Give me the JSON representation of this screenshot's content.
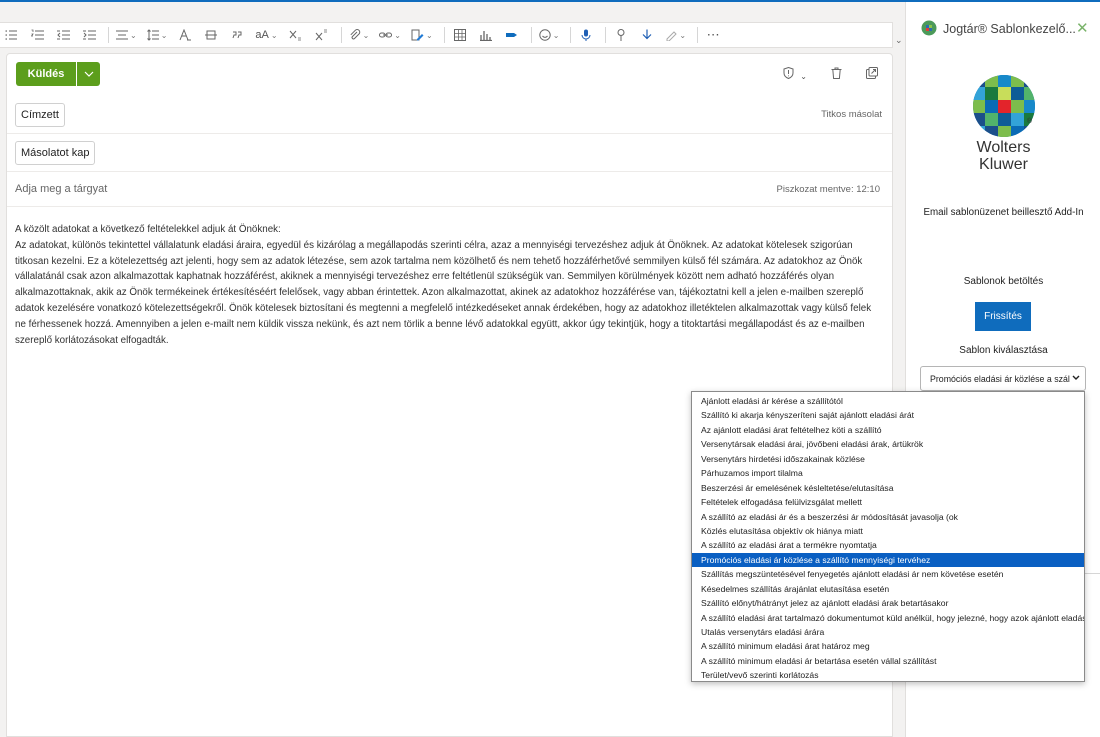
{
  "ribbon": {
    "style_label": "aA"
  },
  "compose": {
    "send_label": "Küldés",
    "to_label": "Címzett",
    "cc_label": "Másolatot kap",
    "bcc_label": "Titkos másolat",
    "subject_placeholder": "Adja meg a tárgyat",
    "draft_saved": "Piszkozat mentve: 12:10",
    "body": [
      "A közölt adatokat a következő feltételekkel adjuk át Önöknek:",
      "Az adatokat, különös tekintettel vállalatunk eladási áraira, egyedül és kizárólag a megállapodás szerinti célra, azaz a mennyiségi tervezéshez adjuk át Önöknek. Az adatokat kötelesek szigorúan titkosan kezelni. Ez a kötelezettség azt jelenti, hogy sem az adatok létezése, sem azok tartalma nem közölhető és nem tehető hozzáférhetővé semmilyen külső fél számára. Az adatokhoz az Önök vállalatánál csak azon alkalmazottak kaphatnak hozzáférést, akiknek a mennyiségi tervezéshez erre feltétlenül szükségük van. Semmilyen körülmények között nem adható hozzáférés olyan alkalmazottaknak, akik az Önök termékeinek értékesítéséért felelősek, vagy abban érintettek. Azon alkalmazottat, akinek az adatokhoz hozzáférése van, tájékoztatni kell a jelen e-mailben szereplő adatok kezelésére vonatkozó kötelezettségekről. Önök kötelesek biztosítani és megtenni a megfelelő intézkedéseket annak érdekében, hogy az adatokhoz illetéktelen alkalmazottak vagy külső felek ne férhessenek hozzá. Amennyiben a jelen e-mailt nem küldik vissza nekünk, és azt nem törlik a benne lévő adatokkal együtt, akkor úgy tekintjük, hogy a titoktartási megállapodást és az e-mailben szereplő korlátozásokat elfogadták."
    ]
  },
  "pane": {
    "title": "Jogtár® Sablonkezelő...",
    "brand_line1": "Wolters",
    "brand_line2": "Kluwer",
    "brand_reg": "®",
    "subtitle": "Email sablonüzenet beillesztő Add-In",
    "load_label": "Sablonok betöltés",
    "refresh_label": "Frissítés",
    "choose_label": "Sablon kiválasztása",
    "selected_value": "Promóciós eladási ár közlése a szállító mennyiségi tervéhez"
  },
  "dropdown": {
    "selected_index": 11,
    "options": [
      "Ajánlott eladási ár kérése a szállítótól",
      "Szállító ki akarja kényszeríteni saját ajánlott eladási árát",
      "Az ajánlott eladási árat feltételhez köti a szállító",
      "Versenytársak eladási árai, jövőbeni eladási árak, ártükrök",
      "Versenytárs hirdetési időszakainak közlése",
      "Párhuzamos import tilalma",
      "Beszerzési ár emelésének késleltetése/elutasítása",
      "Feltételek elfogadása felülvizsgálat mellett",
      "A szállító az eladási ár és a beszerzési ár módosítását javasolja (ok",
      "Közlés elutasítása objektív ok hiánya miatt",
      "A szállító az eladási árat a termékre nyomtatja",
      "Promóciós eladási ár közlése a szállító mennyiségi tervéhez",
      "Szállítás megszüntetésével fenyegetés ajánlott eladási ár nem követése esetén",
      "Késedelmes szállítás árajánlat elutasítása esetén",
      "Szállító előnyt/hátrányt jelez az ajánlott eladási árak betartásakor",
      "A szállító eladási árat tartalmazó dokumentumot küld anélkül, hogy jelezné, hogy azok ajánlott eladási árak",
      "Utalás versenytárs eladási árára",
      "A szállító minimum eladási árat határoz meg",
      "A szállító minimum eladási ár betartása esetén vállal szállítást",
      "Terület/vevő szerinti korlátozás"
    ]
  },
  "colors": {
    "send": "#5c9e1c",
    "accent": "#0f6cbd",
    "selection": "#0a5fc2"
  }
}
